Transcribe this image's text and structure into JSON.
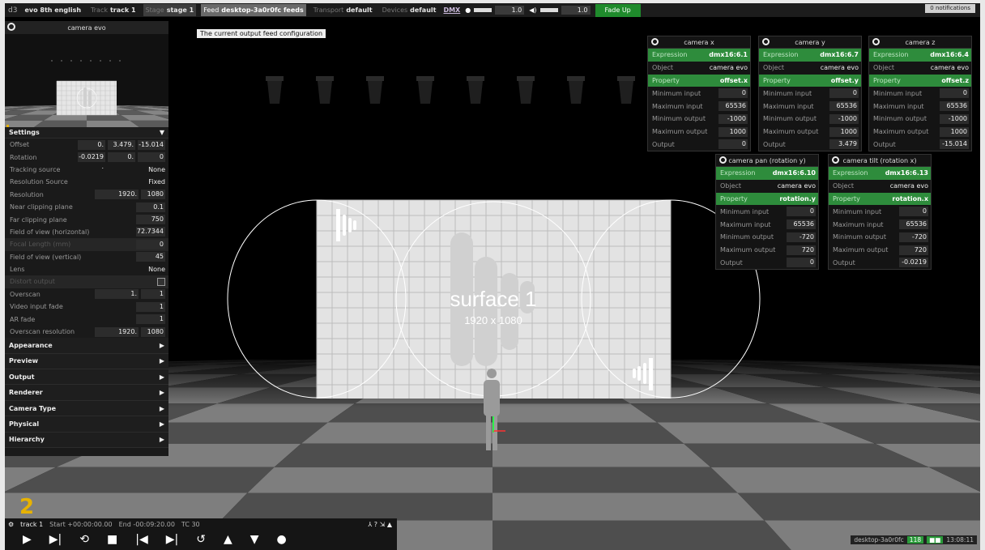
{
  "topbar": {
    "project": "evo 8th english",
    "track_label": "Track",
    "track_value": "track 1",
    "stage_label": "Stage",
    "stage_value": "stage 1",
    "feed_label": "Feed",
    "feed_value": "desktop-3a0r0fc feeds",
    "transport_label": "Transport",
    "transport_value": "default",
    "devices_label": "Devices",
    "devices_value": "default",
    "dmx": "DMX",
    "brightness": "1.0",
    "volume": "1.0",
    "fade_up": "Fade Up",
    "notifications": "0 notifications"
  },
  "tooltip": "The current output feed configuration",
  "left_panel": {
    "title": "camera evo",
    "settings_label": "Settings",
    "rows": [
      {
        "label": "Offset",
        "values": [
          "0.",
          "3.479.",
          "-15.014"
        ]
      },
      {
        "label": "Rotation",
        "values": [
          "-0.0219 .",
          "0.",
          "0"
        ]
      },
      {
        "label": "Tracking source",
        "text": "None"
      },
      {
        "label": "Resolution Source",
        "text": "Fixed"
      },
      {
        "label": "Resolution",
        "values": [
          "1920.",
          "1080"
        ]
      },
      {
        "label": "Near clipping plane",
        "values": [
          "0.1"
        ]
      },
      {
        "label": "Far clipping plane",
        "values": [
          "750"
        ]
      },
      {
        "label": "Field of view (horizontal)",
        "values": [
          "72.7344"
        ]
      },
      {
        "label": "Focal Length (mm)",
        "values": [
          "0"
        ],
        "dim": true
      },
      {
        "label": "Field of view (vertical)",
        "values": [
          "45"
        ]
      },
      {
        "label": "Lens",
        "text": "None"
      },
      {
        "label": "Distort output",
        "checkbox": true,
        "dim": true
      },
      {
        "label": "Overscan",
        "values": [
          "1.",
          "1"
        ]
      },
      {
        "label": "Video input fade",
        "values": [
          "1"
        ]
      },
      {
        "label": "AR fade",
        "values": [
          "1"
        ]
      },
      {
        "label": "Overscan resolution",
        "values": [
          "1920.",
          "1080"
        ]
      }
    ],
    "sections": [
      "Appearance",
      "Preview",
      "Output",
      "Renderer",
      "Camera Type",
      "Physical",
      "Hierarchy"
    ]
  },
  "panels": [
    {
      "title": "camera x",
      "expression": "dmx16:6.1",
      "object": "camera evo",
      "property": "offset.x",
      "min_in": "0",
      "max_in": "65536",
      "min_out": "-1000",
      "max_out": "1000",
      "output": "0"
    },
    {
      "title": "camera y",
      "expression": "dmx16:6.7",
      "object": "camera evo",
      "property": "offset.y",
      "min_in": "0",
      "max_in": "65536",
      "min_out": "-1000",
      "max_out": "1000",
      "output": "3.479"
    },
    {
      "title": "camera z",
      "expression": "dmx16:6.4",
      "object": "camera evo",
      "property": "offset.z",
      "min_in": "0",
      "max_in": "65536",
      "min_out": "-1000",
      "max_out": "1000",
      "output": "-15.014"
    },
    {
      "title": "camera pan (rotation y)",
      "expression": "dmx16:6.10",
      "object": "camera evo",
      "property": "rotation.y",
      "min_in": "0",
      "max_in": "65536",
      "min_out": "-720",
      "max_out": "720",
      "output": "0"
    },
    {
      "title": "camera tilt (rotation x)",
      "expression": "dmx16:6.13",
      "object": "camera evo",
      "property": "rotation.x",
      "min_in": "0",
      "max_in": "65536",
      "min_out": "-720",
      "max_out": "720",
      "output": "-0.0219"
    }
  ],
  "panel_labels": {
    "expression": "Expression",
    "object": "Object",
    "property": "Property",
    "min_in": "Minimum input",
    "max_in": "Maximum input",
    "min_out": "Minimum output",
    "max_out": "Maximum output",
    "output": "Output"
  },
  "surface": {
    "name": "surface 1",
    "resolution": "1920 x 1080"
  },
  "transport": {
    "track": "track 1",
    "start": "Start +00:00:00.00",
    "end": "End -00:09:20.00",
    "tc": "TC 30"
  },
  "status": {
    "feed": "desktop-3a0r0fc",
    "fps": "118",
    "time": "13:08:11"
  },
  "logo": "2"
}
